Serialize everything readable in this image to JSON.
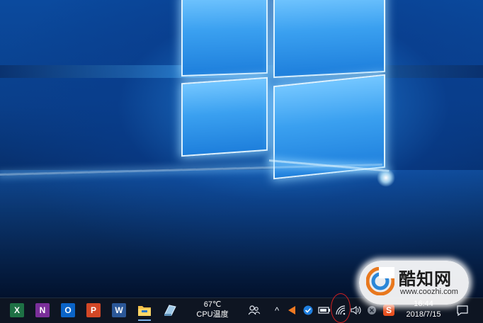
{
  "taskbar": {
    "apps": [
      {
        "name": "excel",
        "glyph": "X",
        "color": "#1e7145"
      },
      {
        "name": "onenote",
        "glyph": "N",
        "color": "#7a2f9a"
      },
      {
        "name": "outlook",
        "glyph": "O",
        "color": "#0a64c8"
      },
      {
        "name": "powerpoint",
        "glyph": "P",
        "color": "#d24726"
      },
      {
        "name": "word",
        "glyph": "W",
        "color": "#2b5797"
      }
    ],
    "cpu_temp": {
      "value": "67℃",
      "label": "CPU温度"
    },
    "tray": {
      "people": "⚇",
      "chevron": "^",
      "wifi": "((·",
      "volume": "🔈",
      "input_method": "S"
    },
    "clock": {
      "time": "16:44",
      "date": "2018/7/15"
    }
  },
  "watermark": {
    "title": "酷知网",
    "url": "www.coozhi.com"
  },
  "colors": {
    "accent": "#d42020",
    "taskbar": "#0e1522"
  }
}
